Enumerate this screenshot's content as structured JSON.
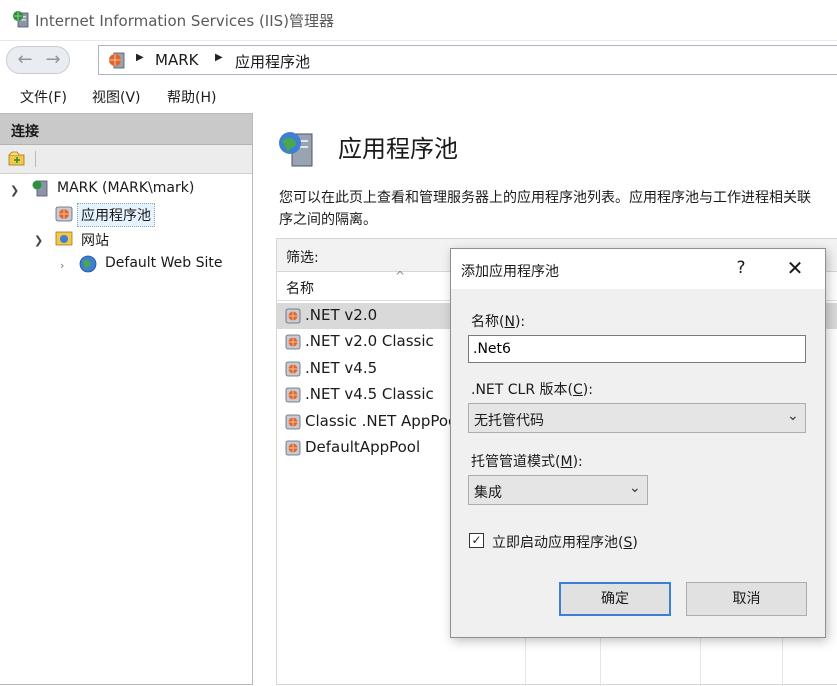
{
  "window": {
    "title": "Internet Information Services (IIS)管理器"
  },
  "address": {
    "crumbs": [
      "MARK",
      "应用程序池"
    ]
  },
  "menu": {
    "items": [
      "文件(F)",
      "视图(V)",
      "帮助(H)"
    ]
  },
  "connections": {
    "title": "连接",
    "tree": {
      "server": "MARK (MARK\\mark)",
      "app_pools": "应用程序池",
      "sites": "网站",
      "default_site": "Default Web Site"
    }
  },
  "main": {
    "title": "应用程序池",
    "description_line1": "您可以在此页上查看和管理服务器上的应用程序池列表。应用程序池与工作进程相关联",
    "description_line2": "序之间的隔离。",
    "filter_label": "筛选:",
    "column_name": "名称",
    "pools": [
      ".NET v2.0",
      ".NET v2.0 Classic",
      ".NET v4.5",
      ".NET v4.5 Classic",
      "Classic .NET AppPool",
      "DefaultAppPool"
    ],
    "selected_pool_index": 0
  },
  "dialog": {
    "title": "添加应用程序池",
    "help": "?",
    "name_label_prefix": "名称(",
    "name_label_key": "N",
    "name_label_suffix": "):",
    "name_value": ".Net6",
    "clr_label_prefix": ".NET CLR 版本(",
    "clr_label_key": "C",
    "clr_label_suffix": "):",
    "clr_value": "无托管代码",
    "pipeline_label_prefix": "托管管道模式(",
    "pipeline_label_key": "M",
    "pipeline_label_suffix": "):",
    "pipeline_value": "集成",
    "start_label_prefix": "立即启动应用程序池(",
    "start_label_key": "S",
    "start_label_suffix": ")",
    "start_checked": true,
    "ok": "确定",
    "cancel": "取消"
  },
  "colors": {
    "accent": "#3c7fd6",
    "selection": "#d9d9d9",
    "panel_header": "#c9c9c9"
  }
}
